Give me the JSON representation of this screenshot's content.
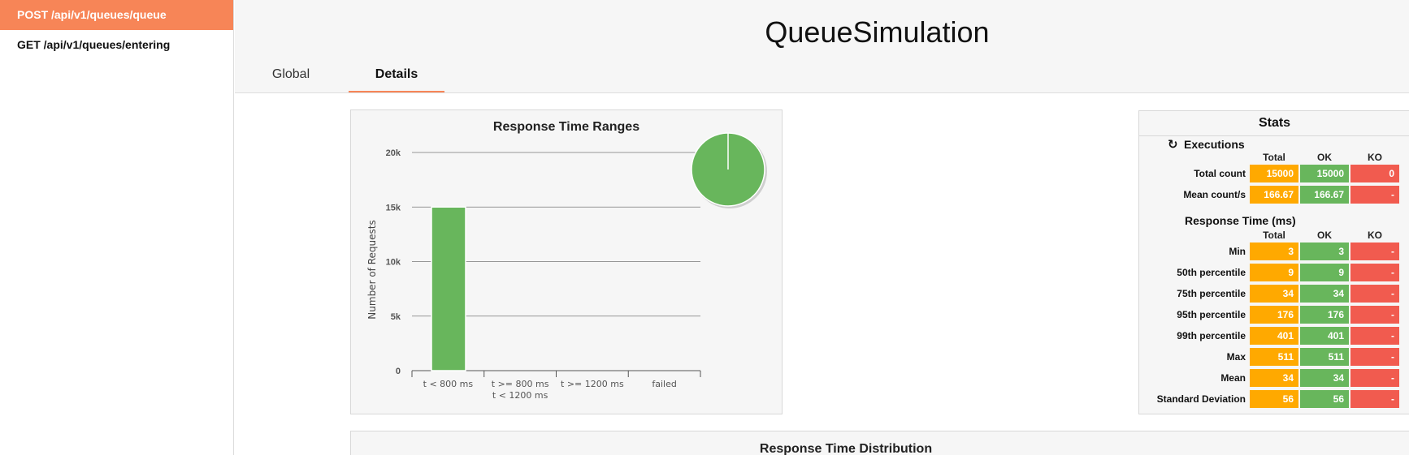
{
  "sidebar": {
    "items": [
      {
        "label": "POST /api/v1/queues/queue"
      },
      {
        "label": "GET /api/v1/queues/entering"
      }
    ]
  },
  "header": {
    "title": "QueueSimulation",
    "tabs": [
      {
        "label": "Global"
      },
      {
        "label": "Details"
      }
    ]
  },
  "chart_data": {
    "type": "bar",
    "title": "Response Time Ranges",
    "ylabel": "Number of Requests",
    "xlabel": "",
    "categories": [
      {
        "line1": "t < 800 ms",
        "line2": ""
      },
      {
        "line1": "t >= 800 ms",
        "line2": "t < 1200 ms"
      },
      {
        "line1": "t >= 1200 ms",
        "line2": ""
      },
      {
        "line1": "failed",
        "line2": ""
      }
    ],
    "values": [
      15000,
      0,
      0,
      0
    ],
    "yticks": [
      "0",
      "5k",
      "10k",
      "15k",
      "20k"
    ],
    "ytick_values": [
      0,
      5000,
      10000,
      15000,
      20000
    ],
    "ylim": [
      0,
      20000
    ],
    "grid": true,
    "legend": "none",
    "bar_color": "#68b65c",
    "pie": {
      "values": [
        15000,
        0,
        0,
        0
      ],
      "colors": [
        "#68b65c",
        "#ffa900",
        "#f78557",
        "#f15b4f"
      ],
      "placement": "top-right"
    }
  },
  "stats": {
    "title": "Stats",
    "executions_label": "Executions",
    "response_time_label": "Response Time (ms)",
    "columns": [
      "Total",
      "OK",
      "KO"
    ],
    "executions": [
      {
        "label": "Total count",
        "total": "15000",
        "ok": "15000",
        "ko": "0"
      },
      {
        "label": "Mean count/s",
        "total": "166.67",
        "ok": "166.67",
        "ko": "-"
      }
    ],
    "response_time": [
      {
        "label": "Min",
        "total": "3",
        "ok": "3",
        "ko": "-"
      },
      {
        "label": "50th percentile",
        "total": "9",
        "ok": "9",
        "ko": "-"
      },
      {
        "label": "75th percentile",
        "total": "34",
        "ok": "34",
        "ko": "-"
      },
      {
        "label": "95th percentile",
        "total": "176",
        "ok": "176",
        "ko": "-"
      },
      {
        "label": "99th percentile",
        "total": "401",
        "ok": "401",
        "ko": "-"
      },
      {
        "label": "Max",
        "total": "511",
        "ok": "511",
        "ko": "-"
      },
      {
        "label": "Mean",
        "total": "34",
        "ok": "34",
        "ko": "-"
      },
      {
        "label": "Standard Deviation",
        "total": "56",
        "ok": "56",
        "ko": "-"
      }
    ],
    "colors": {
      "total": "#ffa900",
      "ok": "#68b65c",
      "ko": "#f15b4f"
    }
  },
  "distribution": {
    "title": "Response Time Distribution"
  }
}
